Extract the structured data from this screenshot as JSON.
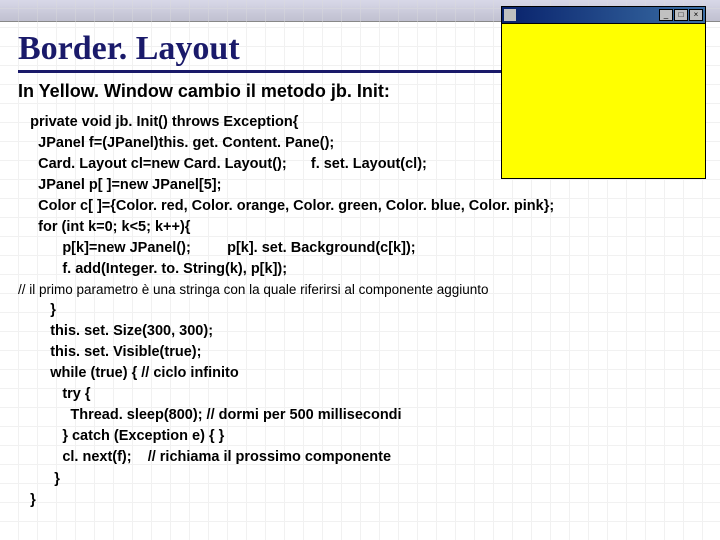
{
  "title": "Border. Layout",
  "subtitle": "In Yellow. Window cambio il metodo jb. Init:",
  "code1": "   private void jb. Init() throws Exception{\n     JPanel f=(JPanel)this. get. Content. Pane();\n     Card. Layout cl=new Card. Layout();      f. set. Layout(cl);\n     JPanel p[ ]=new JPanel[5];\n     Color c[ ]={Color. red, Color. orange, Color. green, Color. blue, Color. pink};\n     for (int k=0; k<5; k++){\n           p[k]=new JPanel();         p[k]. set. Background(c[k]);\n           f. add(Integer. to. String(k), p[k]);",
  "comment1": "// il primo parametro è una stringa con la quale riferirsi al componente aggiunto",
  "code2": "        }\n        this. set. Size(300, 300);\n        this. set. Visible(true);\n        while (true) { // ciclo infinito\n           try {\n             Thread. sleep(800); // dormi per 500 millisecondi\n           } catch (Exception e) { }\n           cl. next(f);    // richiama il prossimo componente\n         }\n   }",
  "window": {
    "min": "_",
    "max": "□",
    "close": "×"
  }
}
